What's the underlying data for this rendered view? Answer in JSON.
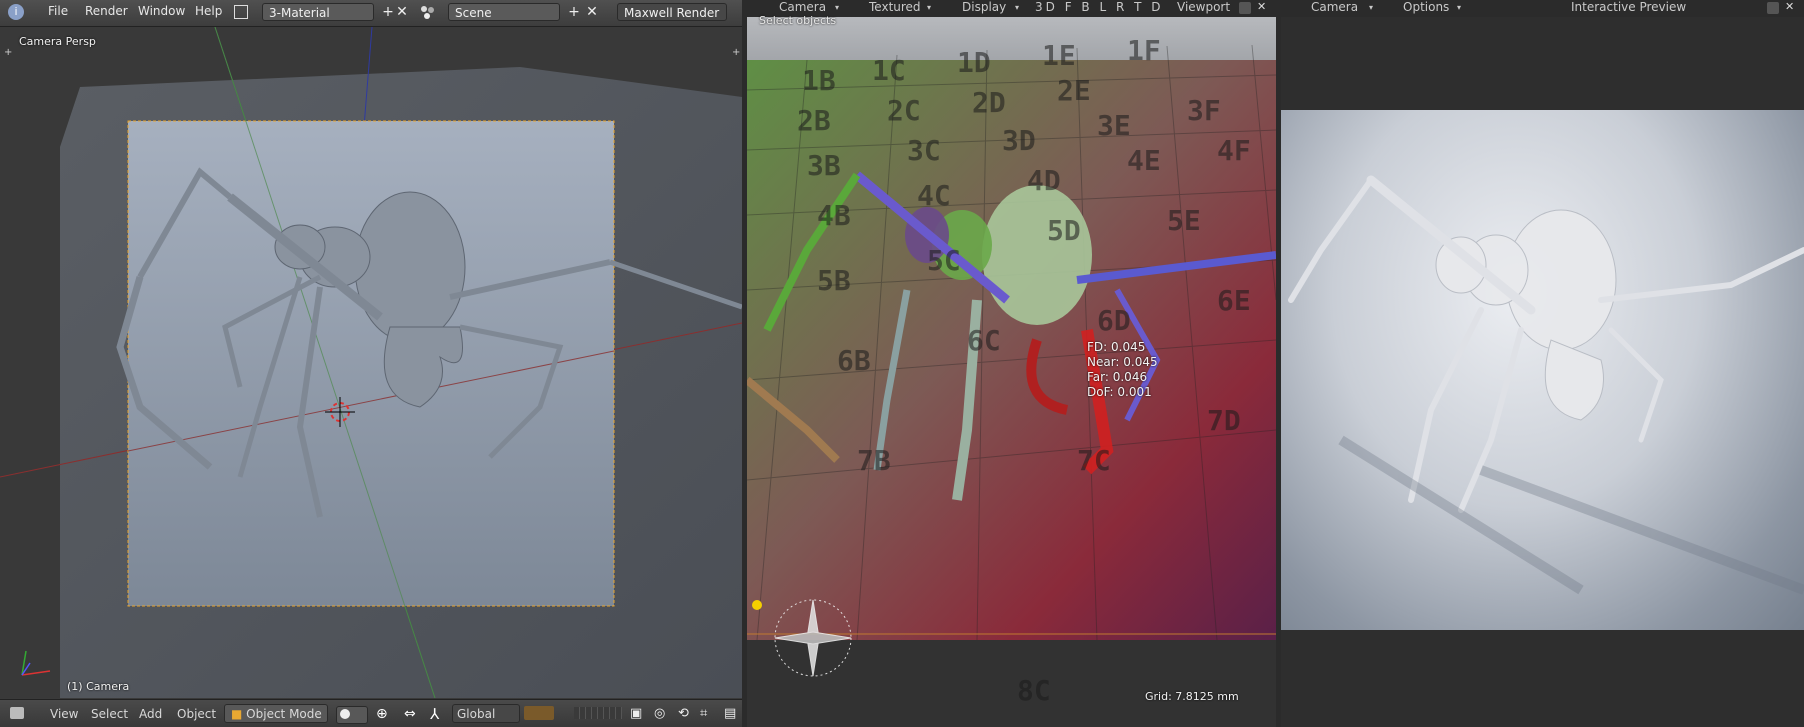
{
  "left": {
    "menu": {
      "file": "File",
      "render": "Render",
      "window": "Window",
      "help": "Help"
    },
    "screen_field": "3-Material",
    "scene_field": "Scene",
    "engine": "Maxwell Render",
    "view_label": "Camera Persp",
    "object_label": "(1) Camera",
    "bottom": {
      "view": "View",
      "select": "Select",
      "add": "Add",
      "object": "Object",
      "mode": "Object Mode",
      "orientation": "Global"
    }
  },
  "middle": {
    "header": {
      "camera": "Camera",
      "textured": "Textured",
      "display": "Display",
      "layers": "3D F B L R T D",
      "viewport": "Viewport"
    },
    "hint": "Select objects",
    "dof": {
      "fd": "FD: 0.045",
      "near": "Near: 0.045",
      "far": "Far: 0.046",
      "dof": "DoF: 0.001"
    },
    "grid": "Grid: 7.8125 mm",
    "chart_labels": [
      "1B",
      "1C",
      "1D",
      "1E",
      "1F",
      "2B",
      "2C",
      "2D",
      "2E",
      "3B",
      "3C",
      "3D",
      "3E",
      "3F",
      "4B",
      "4C",
      "4D",
      "4E",
      "4F",
      "5B",
      "5C",
      "5D",
      "5E",
      "6B",
      "6C",
      "6D",
      "6E",
      "7B",
      "7C",
      "7D",
      "8C"
    ]
  },
  "right": {
    "header": {
      "camera": "Camera",
      "options": "Options",
      "title": "Interactive Preview"
    }
  },
  "colors": {
    "accent_orange": "#e0a030",
    "camera_frame": "#e8a32c",
    "bg_dark": "#2b2b2b"
  }
}
